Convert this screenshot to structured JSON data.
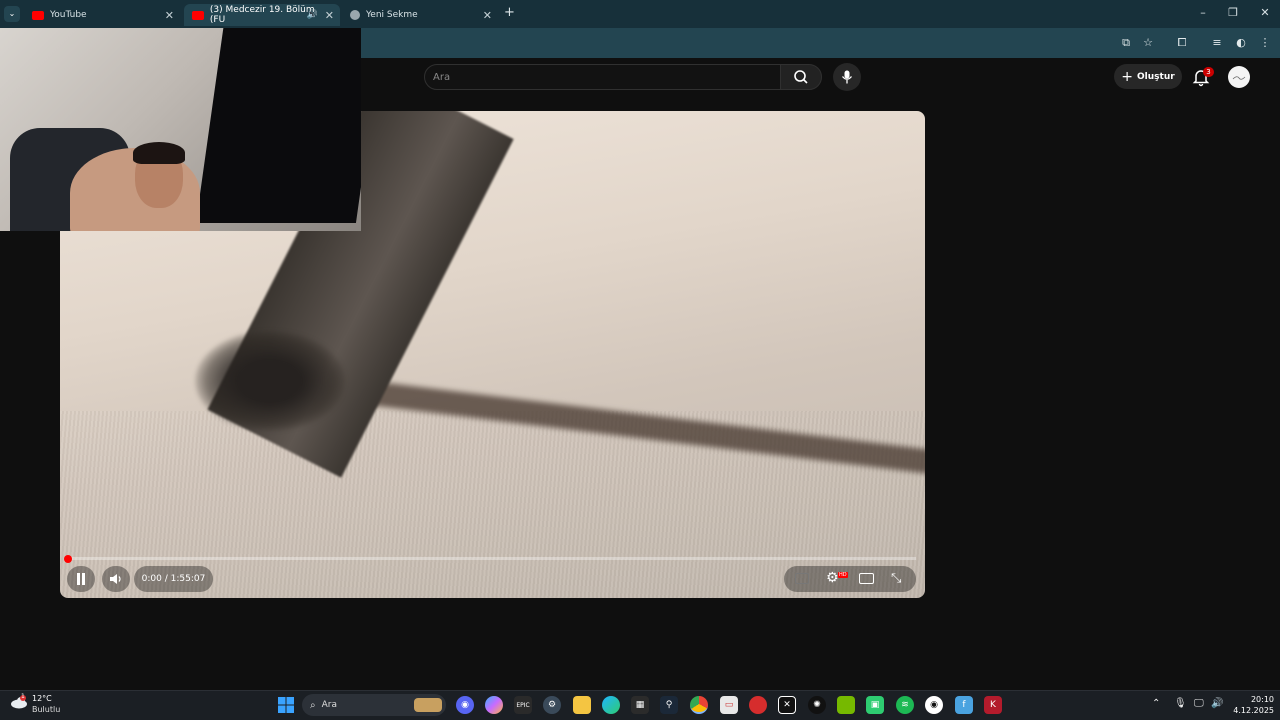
{
  "browser": {
    "tabs": [
      {
        "title": "YouTube",
        "active": false
      },
      {
        "title": "(3) Medcezir 19. Bölüm (FU",
        "active": true
      },
      {
        "title": "Yeni Sekme",
        "active": false
      }
    ],
    "new_tab_icon": "plus-icon"
  },
  "youtube": {
    "search_placeholder": "Ara",
    "create_label": "Oluştur",
    "notification_count": "3"
  },
  "player": {
    "current_time": "0:00",
    "duration": "1:55:07",
    "time_text": "0:00 / 1:55:07",
    "progress": 0.0,
    "state": "paused-icon-shown",
    "quality_badge": "HD",
    "accent_color": "#ff0000"
  },
  "taskbar": {
    "weather_temp": "12°C",
    "weather_desc": "Bulutlu",
    "weather_badge": "1",
    "search_label": "Ara",
    "time": "20:10",
    "date": "4.12.2025",
    "apps": [
      "windows-start-icon",
      "discord-icon",
      "copilot-icon",
      "epic-games-icon",
      "settings-icon",
      "file-explorer-icon",
      "edge-icon",
      "store-icon",
      "steam-icon",
      "chrome-icon",
      "app-icon",
      "app-icon-red",
      "capcut-icon",
      "chatgpt-icon",
      "nvidia-icon",
      "app-green-icon",
      "spotify-icon",
      "obs-icon",
      "app-blue-icon",
      "app-red-k-icon"
    ]
  }
}
